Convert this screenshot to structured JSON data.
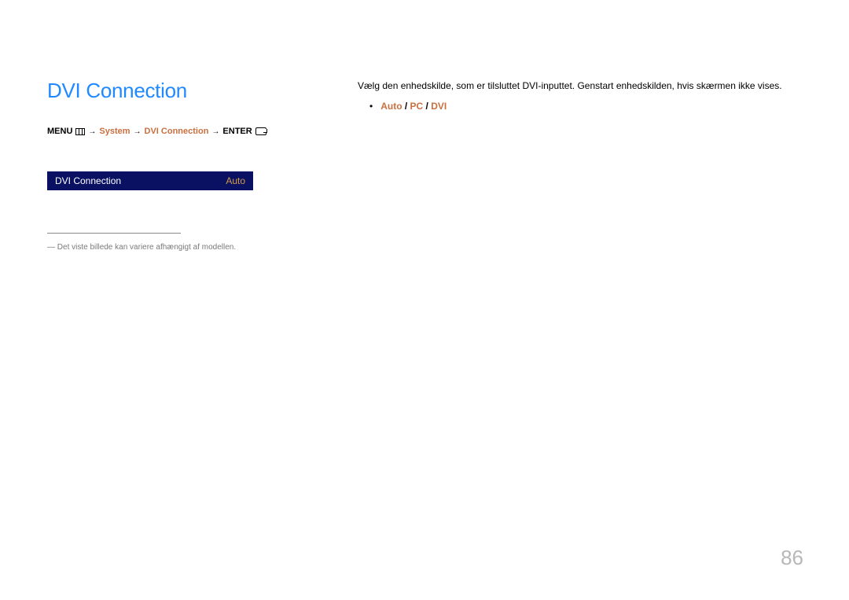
{
  "heading": "DVI Connection",
  "breadcrumb": {
    "menu": "MENU",
    "system": "System",
    "dvi": "DVI Connection",
    "enter": "ENTER",
    "arrow": "→"
  },
  "toggle": {
    "label": "DVI Connection",
    "value": "Auto"
  },
  "note": {
    "dash": "―",
    "text": "Det viste billede kan variere afhængigt af modellen."
  },
  "body": "Vælg den enhedskilde, som er tilsluttet DVI-inputtet. Genstart enhedskilden, hvis skærmen ikke vises.",
  "options": {
    "auto": "Auto",
    "pc": "PC",
    "dvi": "DVI",
    "sep": " / "
  },
  "page_number": "86"
}
